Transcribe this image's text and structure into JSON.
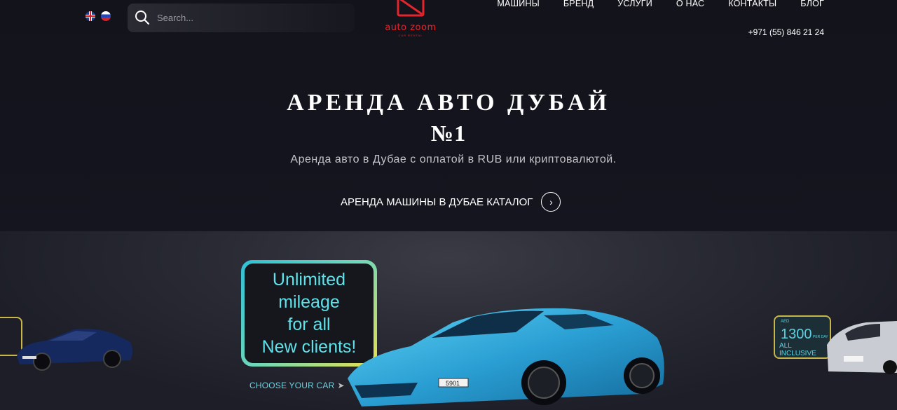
{
  "header": {
    "languages": [
      {
        "code": "en",
        "icon": "uk-flag-icon"
      },
      {
        "code": "ru",
        "icon": "ru-flag-icon"
      }
    ],
    "search": {
      "placeholder": "Search...",
      "value": ""
    },
    "logo": {
      "brand": "auto zoom",
      "tagline": "CAR RENTAL"
    },
    "nav": [
      "МАШИНЫ",
      "БРЕНД",
      "УСЛУГИ",
      "О НАС",
      "КОНТАКТЫ",
      "БЛОГ"
    ],
    "phone": "+971 (55) 846 21 24"
  },
  "hero": {
    "title_line1": "АРЕНДА АВТО ДУБАЙ",
    "title_line2": "№1",
    "subtitle": "Аренда авто в Дубае с оплатой в RUB или криптовалютой.",
    "cta_label": "АРЕНДА МАШИНЫ В ДУБАЕ КАТАЛОГ"
  },
  "slider": {
    "promo_lines": [
      "Unlimited",
      "mileage",
      "for all",
      "New clients!"
    ],
    "choose_label": "CHOOSE YOUR CAR",
    "price_badge": {
      "currency": "AED",
      "amount": "1300",
      "period": "PER DAY",
      "note": "ALL INCLUSIVE"
    },
    "plate": "5901"
  },
  "colors": {
    "background": "#14141d",
    "brand_red": "#e3262d",
    "promo_cyan": "#5fe2ea",
    "promo_yellow": "#e9e04a"
  }
}
